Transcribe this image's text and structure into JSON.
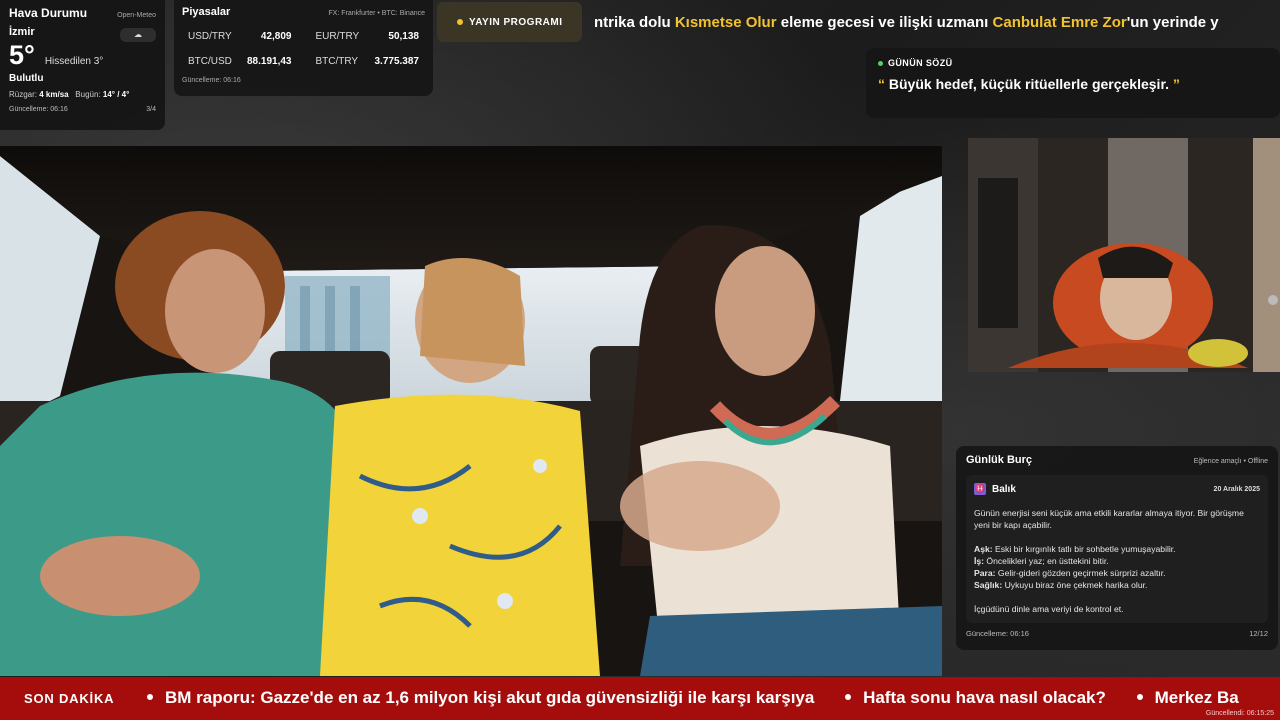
{
  "weather": {
    "title": "Hava Durumu",
    "source": "Open-Meteo",
    "city": "İzmir",
    "icon": "cloud-icon",
    "icon_glyph": "☁",
    "temp": "5°",
    "feels": "Hissedilen 3°",
    "condition": "Bulutlu",
    "wind_label": "Rüzgar:",
    "wind_value": "4 km/sa",
    "today_label": "Bugün:",
    "today_value": "14° / 4°",
    "updated": "Güncelleme: 06:16",
    "page": "3/4"
  },
  "markets": {
    "title": "Piyasalar",
    "source": "FX: Frankfurter • BTC: Binance",
    "rows": [
      {
        "label": "USD/TRY",
        "value": "42,809"
      },
      {
        "label": "EUR/TRY",
        "value": "50,138"
      },
      {
        "label": "BTC/USD",
        "value": "88.191,43"
      },
      {
        "label": "BTC/TRY",
        "value": "3.775.387"
      }
    ],
    "updated": "Güncelleme: 06:16"
  },
  "schedule": {
    "label": "YAYIN PROGRAMI"
  },
  "top_ticker": {
    "part1": "ntrika dolu ",
    "hl1": "Kısmetse Olur",
    "part2": " eleme gecesi ve ilişki uzmanı ",
    "hl2": "Canbulat Emre Zor",
    "part3": "'un yerinde y"
  },
  "quote": {
    "title": "GÜNÜN SÖZÜ",
    "open": "“",
    "text": "Büyük hedef, küçük ritüellerle gerçekleşir.",
    "close": "”"
  },
  "horoscope": {
    "title": "Günlük Burç",
    "mode": "Eğlence amaçlı • Offline",
    "sign_glyph": "♓",
    "sign": "Balık",
    "date": "20 Aralık 2025",
    "intro": "Günün enerjisi seni küçük ama etkili kararlar almaya itiyor. Bir görüşme yeni bir kapı açabilir.",
    "love_label": "Aşk:",
    "love": " Eski bir kırgınlık tatlı bir sohbetle yumuşayabilir.",
    "work_label": "İş:",
    "work": " Öncelikleri yaz; en üsttekini bitir.",
    "money_label": "Para:",
    "money": " Gelir-gideri gözden geçirmek sürprizi azaltır.",
    "health_label": "Sağlık:",
    "health": " Uykuyu biraz öne çekmek harika olur.",
    "outro": "İçgüdünü dinle ama veriyi de kontrol et.",
    "updated": "Güncelleme: 06:16",
    "page": "12/12"
  },
  "bottom_ticker": {
    "label": "SON DAKİKA",
    "items": [
      "BM raporu: Gazze'de en az 1,6 milyon kişi akut gıda güvensizliği ile karşı karşıya",
      "Hafta sonu hava nasıl olacak?",
      "Merkez Ba"
    ],
    "updated": "Güncellendi: 06:15:25"
  }
}
